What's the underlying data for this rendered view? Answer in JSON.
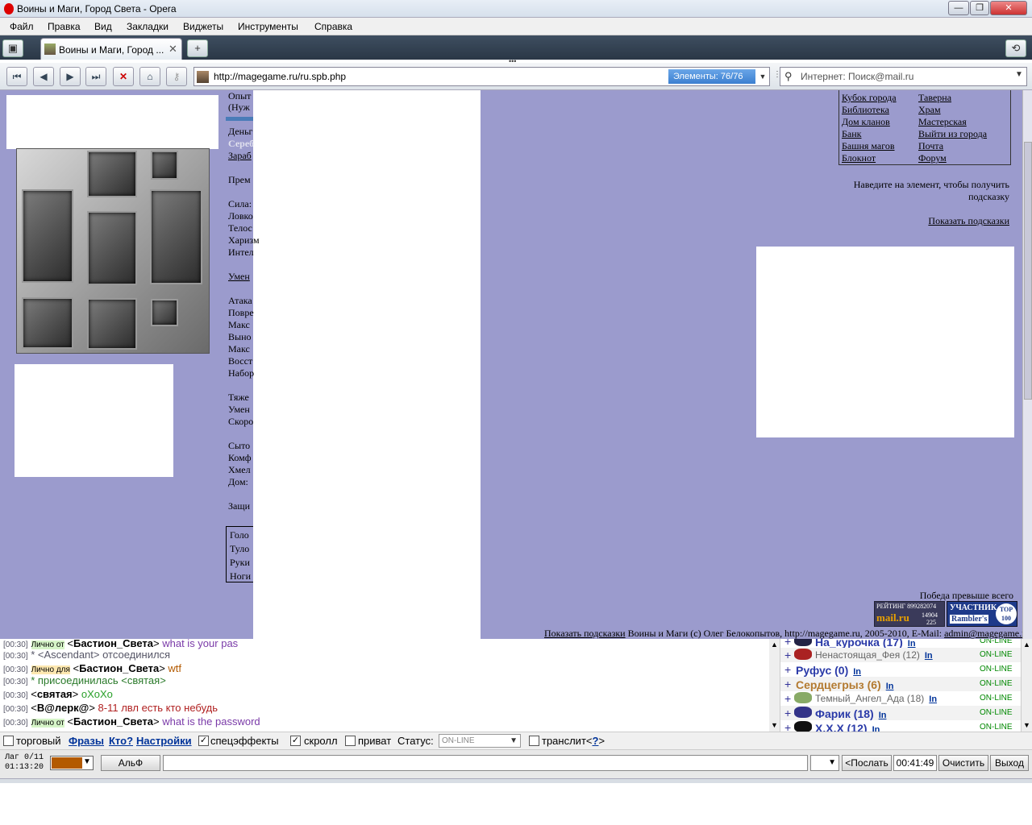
{
  "window": {
    "title": "Воины и Маги, Город Света - Opera",
    "controls": {
      "minimize": "—",
      "maximize": "❐",
      "close": "✕"
    }
  },
  "menu": [
    "Файл",
    "Правка",
    "Вид",
    "Закладки",
    "Виджеты",
    "Инструменты",
    "Справка"
  ],
  "tabs": {
    "active_label": "Воины и Маги, Город ...",
    "add": "+",
    "close": "✕"
  },
  "address": {
    "url": "http://magegame.ru/ru.spb.php",
    "elements_label": "Элементы:",
    "elements_value": "76/76",
    "search_placeholder": "Интернет: Поиск@mail.ru"
  },
  "icons": {
    "panel": "panel-toggle-icon",
    "rewind": "rewind-icon",
    "back": "back-icon",
    "forward": "forward-icon",
    "fast_forward": "fast-forward-icon",
    "stop": "stop-icon",
    "home": "home-icon",
    "key": "key-icon",
    "search": "search-icon",
    "closed_tabs": "closed-tabs-icon"
  },
  "page": {
    "stats": [
      {
        "text": "Опыт",
        "underline": false
      },
      {
        "text": "(Нуж",
        "underline": false
      },
      {
        "text": "Деньг",
        "underline": false
      },
      {
        "text": "Сереб",
        "underline": false
      },
      {
        "text": "Зараб",
        "underline": true
      },
      {
        "text": "Прем",
        "underline": false
      },
      {
        "text": "Сила:",
        "underline": false
      },
      {
        "text": "Ловко",
        "underline": false
      },
      {
        "text": "Телос",
        "underline": false
      },
      {
        "text": "Харизм",
        "underline": false
      },
      {
        "text": "Интел",
        "underline": false
      },
      {
        "text": "Умен",
        "underline": true
      },
      {
        "text": "Атака",
        "underline": false
      },
      {
        "text": "Повре",
        "underline": false
      },
      {
        "text": "Макс",
        "underline": false
      },
      {
        "text": "Выно",
        "underline": false
      },
      {
        "text": "Макс",
        "underline": false
      },
      {
        "text": "Восст",
        "underline": false
      },
      {
        "text": "Набор",
        "underline": false
      },
      {
        "text": "Тяже",
        "underline": false
      },
      {
        "text": "Умен",
        "underline": false
      },
      {
        "text": "Скоро",
        "underline": false
      },
      {
        "text": "Сыто",
        "underline": false
      },
      {
        "text": "Комф",
        "underline": false
      },
      {
        "text": "Хмел",
        "underline": false
      },
      {
        "text": "Дом:",
        "underline": false
      },
      {
        "text": "Защи",
        "underline": false
      }
    ],
    "armor": [
      "Голо",
      "Туло",
      "Руки",
      "Ноги"
    ],
    "city_links_left": [
      "Кубок города",
      "Библиотека",
      "Дом кланов",
      "Банк",
      "Башня магов",
      "Блокнот"
    ],
    "city_links_right": [
      "Таверна",
      "Храм",
      "Мастерская",
      "Выйти из города",
      "Почта",
      "Форум"
    ],
    "hint_line1": "Наведите на элемент, чтобы получить",
    "hint_line2": "подсказку",
    "show_hints": "Показать подсказки",
    "motto": "Победа превыше всего",
    "footer_link": "Показать подсказки",
    "footer_text": " Воины и Маги (c) Олег Белокопытов, http://magegame.ru, 2005-2010, E-Mail: ",
    "footer_email": "admin@magegame.ru",
    "badge_mail": {
      "line1": "РЕЙТИНГ 899282074",
      "line2": "mail.ru",
      "line3": "14904",
      "line4": "225"
    },
    "badge_rambler": {
      "line1": "УЧАСТНИК",
      "line2": "Rambler's",
      "top_label": "TOP",
      "top_num": "100"
    }
  },
  "chat": {
    "lines": [
      {
        "ts": "[00:30]",
        "tag": "Лично от",
        "open": " <",
        "nick": "Бастион_Света",
        "close": ">",
        "msg": " what is your pas",
        "msgColor": "#7a3aa8",
        "tagClass": "tag-pm"
      },
      {
        "ts": "[00:30]",
        "tag": "",
        "open": " * <",
        "nick": "Ascendant",
        "close": "> отсоединился",
        "msg": "",
        "msgColor": "#556",
        "tagClass": "",
        "nickColor": "#556"
      },
      {
        "ts": "[00:30]",
        "tag": "Лично для",
        "open": " <",
        "nick": "Бастион_Света",
        "close": ">",
        "msg": " wtf",
        "msgColor": "#b35a00",
        "tagClass": "tag-pm2"
      },
      {
        "ts": "[00:30]",
        "tag": "",
        "open": " * присоединилась <",
        "nick": "святая",
        "close": ">",
        "msg": "",
        "msgColor": "#2a7a2a",
        "tagClass": "",
        "nickColor": "#2a7a2a"
      },
      {
        "ts": "[00:30]",
        "tag": "",
        "open": " <",
        "nick": "святая",
        "close": ">",
        "msg": " oXoXo",
        "msgColor": "#2aa02a",
        "tagClass": ""
      },
      {
        "ts": "[00:30]",
        "tag": "",
        "open": " <",
        "nick": "B@лерк@",
        "close": ">",
        "msg": " 8-11 лвл есть кто небудь",
        "msgColor": "#b02020",
        "tagClass": ""
      },
      {
        "ts": "[00:30]",
        "tag": "Лично от",
        "open": " <",
        "nick": "Бастион_Света",
        "close": ">",
        "msg": " what is the password",
        "msgColor": "#7a3aa8",
        "tagClass": "tag-pm"
      }
    ]
  },
  "userlist": {
    "users": [
      {
        "plus": "+",
        "name": "На_курочка (17)",
        "in": "In",
        "status": "ON-LINE",
        "color": "#2a3aa8",
        "bold": true,
        "ava": "#224"
      },
      {
        "plus": "+",
        "name": "Ненастоящая_Фея (12)",
        "in": "In",
        "status": "ON-LINE",
        "color": "#666",
        "bold": false,
        "ava": "#a22"
      },
      {
        "plus": "+",
        "name": "Руфус (0)",
        "in": "In",
        "status": "ON-LINE",
        "color": "#2a3aa8",
        "bold": true,
        "ava": ""
      },
      {
        "plus": "+",
        "name": "Сердцегрыз (6)",
        "in": "In",
        "status": "ON-LINE",
        "color": "#b37a30",
        "bold": true,
        "ava": ""
      },
      {
        "plus": "+",
        "name": "Темный_Ангел_Ада (18)",
        "in": "In",
        "status": "ON-LINE",
        "color": "#666",
        "bold": false,
        "ava": "#8a6"
      },
      {
        "plus": "+",
        "name": "Фарик (18)",
        "in": "In",
        "status": "ON-LINE",
        "color": "#2a3aa8",
        "bold": true,
        "ava": "#338"
      },
      {
        "plus": "+",
        "name": "X.X.X (12)",
        "in": "In",
        "status": "ON-LINE",
        "color": "#2a3aa8",
        "bold": true,
        "ava": "#111"
      }
    ]
  },
  "options": {
    "trade": "торговый",
    "phrases": "Фразы",
    "who": "Кто?",
    "settings": "Настройки",
    "effects": "спецэффекты",
    "scroll": "скролл",
    "private": "приват",
    "status_label": "Статус:",
    "status_value": "ON-LINE",
    "translit": "транслит",
    "translit_help_open": "<",
    "translit_help": "?",
    "translit_help_close": ">"
  },
  "input": {
    "lag": "Лаг 0/11\n01:13:20",
    "alf": "АльФ",
    "send": "<Послать",
    "timer": "00:41:49",
    "clear": "Очистить",
    "exit": "Выход"
  }
}
